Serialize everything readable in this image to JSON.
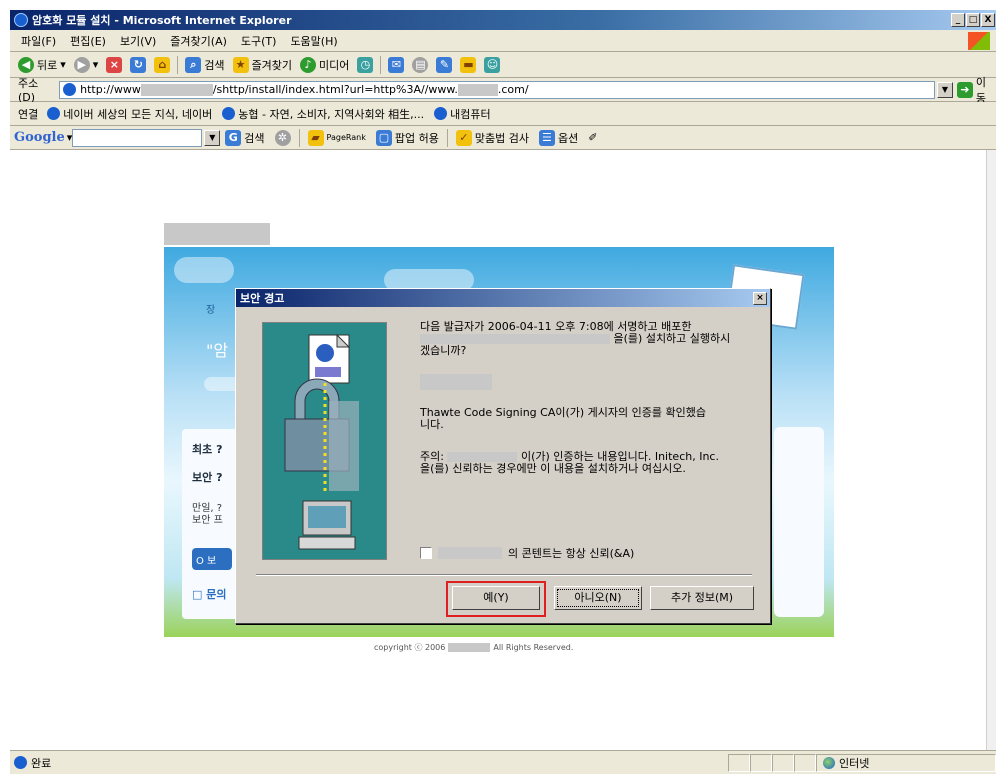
{
  "window": {
    "title": "암호화 모듈 설치 - Microsoft Internet Explorer",
    "controls": [
      "_",
      "□",
      "X"
    ]
  },
  "menubar": {
    "items": [
      "파일(F)",
      "편집(E)",
      "보기(V)",
      "즐겨찾기(A)",
      "도구(T)",
      "도움말(H)"
    ]
  },
  "toolbar": {
    "back": "뒤로",
    "search": "검색",
    "favorites": "즐겨찾기",
    "media": "미디어"
  },
  "address": {
    "label": "주소(D)",
    "url_part_1": "http://www",
    "url_part_2": "/shttp/install/index.html?url=http%3A//www.",
    "url_part_3": ".com/",
    "go": "이동"
  },
  "links": {
    "label": "연결",
    "items": [
      "네이버  세상의 모든 지식, 네이버",
      "농협 - 자연, 소비자, 지역사회와 相生,...",
      "내컴퓨터"
    ]
  },
  "googlebar": {
    "logo": "Google",
    "search": "검색",
    "pagerank": "PageRank",
    "popup": "팝업 허용",
    "spell": "맞춤법 검사",
    "options": "옵션"
  },
  "page": {
    "banner_text_1": "장",
    "banner_text_2": "\"암",
    "panel_title": "최초 ?",
    "panel_sub": "보안 ?",
    "panel_body_1": "만일, ?",
    "panel_body_2": "보안 프",
    "panel_button": "O 보",
    "panel_link": "□ 문의",
    "copyright_1": "copyright ⓒ 2006",
    "copyright_2": "All Rights Reserved."
  },
  "dialog": {
    "title": "보안 경고",
    "line_1": "다음 발급자가 2006-04-11 오후 7:08에 서명하고 배포한",
    "line_2": "을(를) 설치하고 실행하시",
    "line_3": "겠습니까?",
    "verified_1": "Thawte Code Signing CA이(가) 게시자의 인증를 확인했습",
    "verified_2": "니다.",
    "note_prefix": "주의:",
    "note_1": "이(가) 인증하는 내용입니다. Initech, Inc.",
    "note_2": "을(를) 신뢰하는 경우에만 이 내용을 설치하거나 여십시오.",
    "checkbox_label": "의 콘텐트는 항상 신뢰(&A)",
    "buttons": {
      "yes": "예(Y)",
      "no": "아니오(N)",
      "more": "추가 정보(M)"
    }
  },
  "status": {
    "text": "완료",
    "zone": "인터넷"
  },
  "colors": {
    "highlight": "#e02020",
    "titlebar": "#0a246a"
  }
}
